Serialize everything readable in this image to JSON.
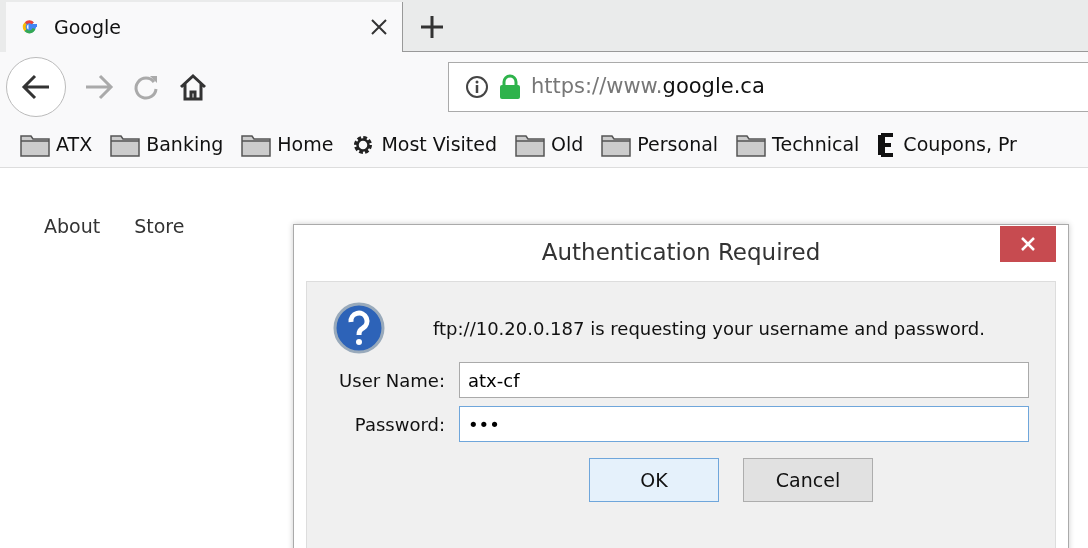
{
  "tabs": [
    {
      "title": "Google",
      "selected": true
    }
  ],
  "toolbar": {
    "url_prefix": "https://www.",
    "url_domain": "google.ca"
  },
  "bookmarks": [
    {
      "kind": "folder",
      "label": "ATX"
    },
    {
      "kind": "folder",
      "label": "Banking"
    },
    {
      "kind": "folder",
      "label": "Home"
    },
    {
      "kind": "gear",
      "label": "Most Visited"
    },
    {
      "kind": "folder",
      "label": "Old"
    },
    {
      "kind": "folder",
      "label": "Personal"
    },
    {
      "kind": "folder",
      "label": "Technical"
    },
    {
      "kind": "letter",
      "label": "Coupons, Pr"
    }
  ],
  "page": {
    "links": [
      "About",
      "Store"
    ]
  },
  "dialog": {
    "title": "Authentication Required",
    "message": "ftp://10.20.0.187 is requesting your username and password.",
    "fields": [
      {
        "label": "User Name:",
        "value": "atx-cf",
        "focused": false
      },
      {
        "label": "Password:",
        "value": "•••",
        "focused": true
      }
    ],
    "buttons": [
      {
        "label": "OK",
        "default": true
      },
      {
        "label": "Cancel",
        "default": false
      }
    ]
  }
}
